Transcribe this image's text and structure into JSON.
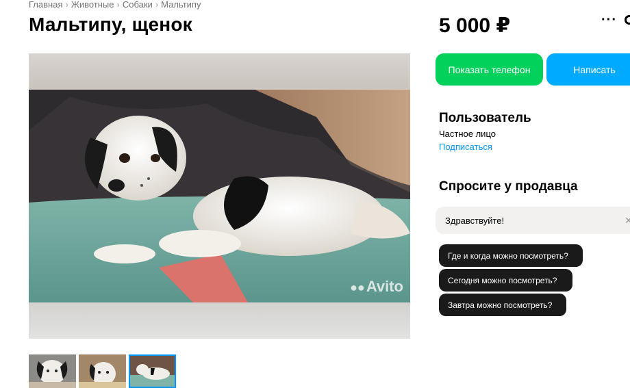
{
  "breadcrumb": [
    "Главная",
    "Животные",
    "Собаки",
    "Мальтипу"
  ],
  "title": "Мальтипу, щенок",
  "price": "5 000 ₽",
  "actions": {
    "phone": "Показать телефон",
    "write": "Написать"
  },
  "seller": {
    "name": "Пользователь",
    "type": "Частное лицо",
    "subscribe": "Подписаться"
  },
  "ask": {
    "title": "Спросите у продавца",
    "input_value": "Здравствуйте!",
    "suggestions": [
      "Где и когда можно посмотреть?",
      "Сегодня можно посмотреть?",
      "Завтра можно посмотреть?"
    ]
  },
  "gallery": {
    "watermark": "Avito",
    "thumbnail_count": 3,
    "active_thumbnail": 3
  },
  "icons": {
    "more": "more-dots-icon",
    "favorite": "favorite-icon",
    "clear": "clear-icon"
  },
  "colors": {
    "phone_button": "#02d15c",
    "write_button": "#00aaff",
    "link": "#0099f7",
    "chip": "#1a1a1a"
  }
}
